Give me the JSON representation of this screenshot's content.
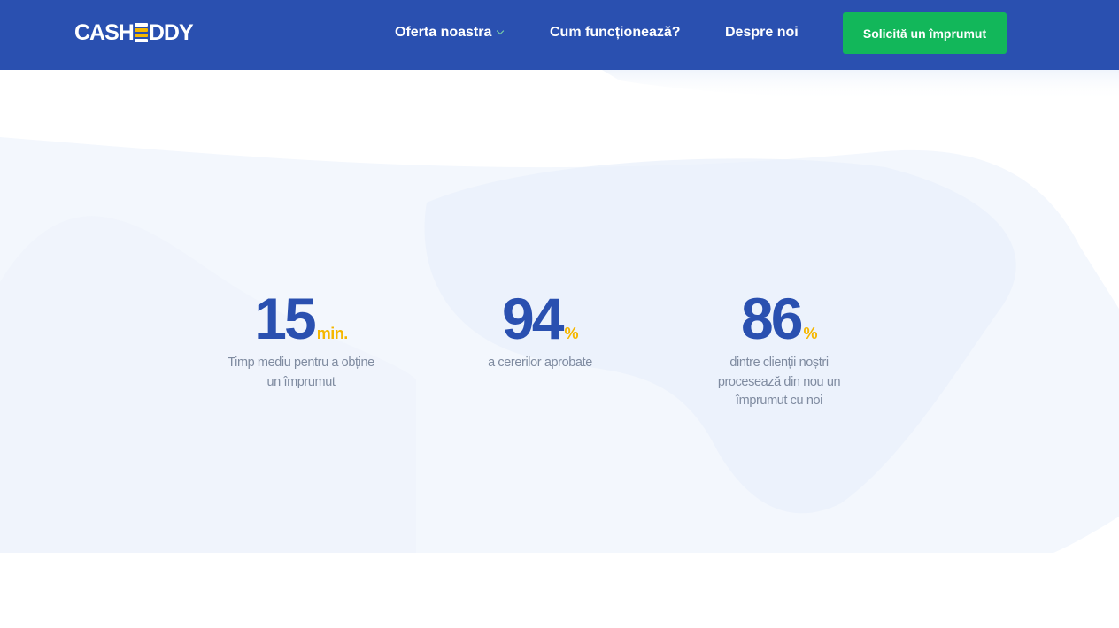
{
  "header": {
    "logo_left": "CASH",
    "logo_right": "DDY",
    "nav": {
      "offer": "Oferta noastra",
      "how": "Cum funcționează?",
      "about": "Despre noi"
    },
    "cta": "Solicită un împrumut"
  },
  "stats": [
    {
      "value": "15",
      "unit": "min.",
      "description_lines": [
        "Timp mediu pentru a obține",
        "un împrumut"
      ]
    },
    {
      "value": "94",
      "unit": "%",
      "description_lines": [
        "a cererilor aprobate"
      ]
    },
    {
      "value": "86",
      "unit": "%",
      "description_lines": [
        "dintre clienții noștri",
        "procesează din nou un",
        "împrumut cu noi"
      ]
    }
  ],
  "colors": {
    "header_bg": "#2a50b0",
    "cta_bg": "#12b75a",
    "accent_yellow": "#f5b700",
    "number_blue": "#2a50b0",
    "text_gray": "#7f8ba0",
    "band_bg": "#f3f7fd"
  },
  "icons": {
    "nav_offer_dropdown": "chevron-down-icon",
    "logo_mark": "stacked-bars-e-icon"
  }
}
